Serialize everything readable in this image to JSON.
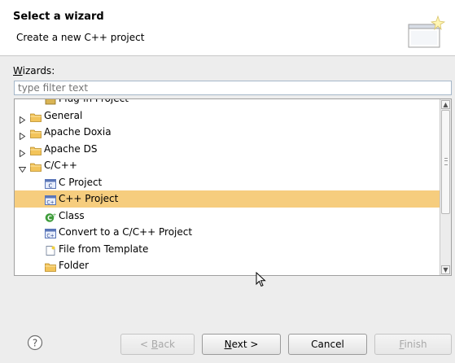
{
  "header": {
    "title": "Select a wizard",
    "subtitle": "Create a new C++ project"
  },
  "wizards": {
    "label_prefix": "W",
    "label_rest": "izards:",
    "filter_placeholder": "type filter text"
  },
  "tree": {
    "items": [
      {
        "label": "Plug-in Project",
        "icon": "project-icon",
        "level": 1,
        "expand": "none"
      },
      {
        "label": "General",
        "icon": "folder-icon",
        "level": 0,
        "expand": "collapsed"
      },
      {
        "label": "Apache Doxia",
        "icon": "folder-icon",
        "level": 0,
        "expand": "collapsed"
      },
      {
        "label": "Apache DS",
        "icon": "folder-icon",
        "level": 0,
        "expand": "collapsed"
      },
      {
        "label": "C/C++",
        "icon": "folder-icon",
        "level": 0,
        "expand": "expanded"
      },
      {
        "label": "C Project",
        "icon": "c-project-icon",
        "level": 1,
        "expand": "none"
      },
      {
        "label": "C++ Project",
        "icon": "cpp-project-icon",
        "level": 1,
        "expand": "none",
        "selected": true
      },
      {
        "label": "Class",
        "icon": "class-icon",
        "level": 1,
        "expand": "none"
      },
      {
        "label": "Convert to a C/C++ Project",
        "icon": "convert-icon",
        "level": 1,
        "expand": "none"
      },
      {
        "label": "File from Template",
        "icon": "file-template-icon",
        "level": 1,
        "expand": "none"
      },
      {
        "label": "Folder",
        "icon": "folder-icon",
        "level": 1,
        "expand": "none"
      }
    ]
  },
  "buttons": {
    "back": {
      "pre": "< ",
      "u": "B",
      "post": "ack"
    },
    "next": {
      "u": "N",
      "post": "ext >"
    },
    "cancel": "Cancel",
    "finish": {
      "u": "F",
      "post": "inish"
    }
  },
  "colors": {
    "selection": "#f6cd7e",
    "folder": "#f3c45a",
    "class_icon": "#3e9c3a"
  }
}
